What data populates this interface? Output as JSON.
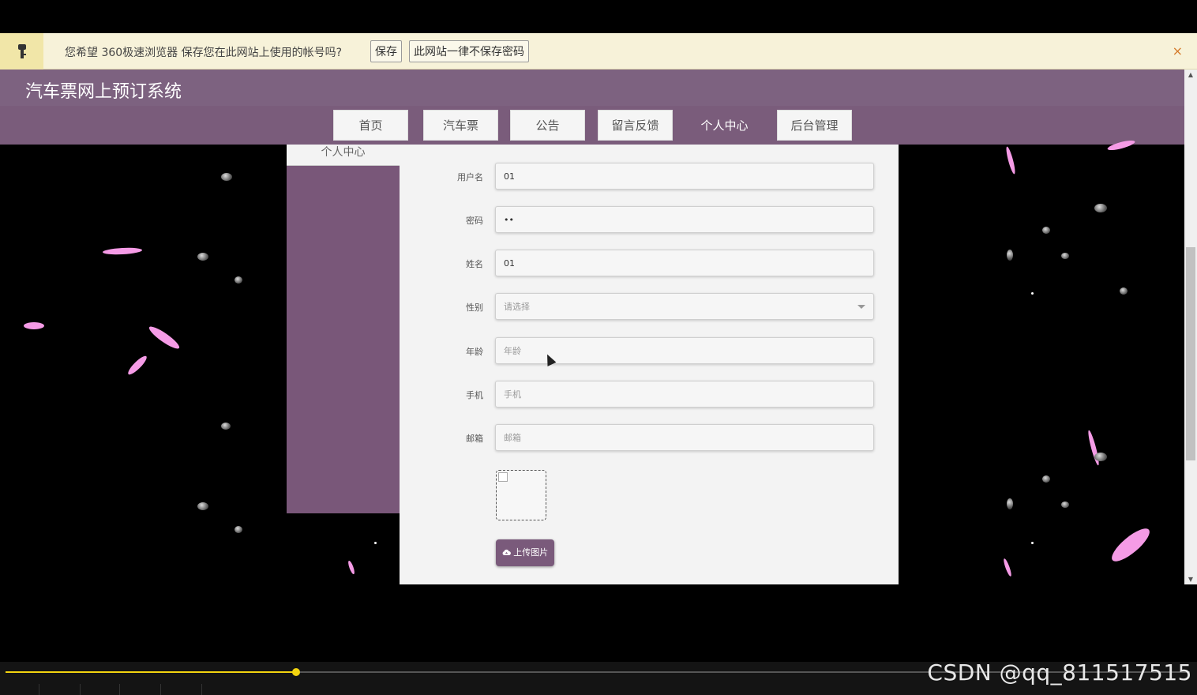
{
  "browser_savebar": {
    "message": "您希望 360极速浏览器 保存您在此网站上使用的帐号吗?",
    "save_label": "保存",
    "never_label": "此网站一律不保存密码",
    "close_label": "×"
  },
  "site": {
    "title": "汽车票网上预订系统"
  },
  "nav": {
    "items": [
      "首页",
      "汽车票",
      "公告",
      "留言反馈",
      "个人中心",
      "后台管理"
    ],
    "active": "个人中心"
  },
  "sidebar": {
    "items": [
      "个人中心"
    ]
  },
  "form": {
    "username": {
      "label": "用户名",
      "value": "01"
    },
    "password": {
      "label": "密码",
      "value": "••"
    },
    "name": {
      "label": "姓名",
      "value": "01"
    },
    "gender": {
      "label": "性别",
      "placeholder": "请选择"
    },
    "age": {
      "label": "年龄",
      "placeholder": "年龄"
    },
    "phone": {
      "label": "手机",
      "placeholder": "手机"
    },
    "email": {
      "label": "邮箱",
      "placeholder": "邮箱"
    },
    "upload_label": "上传图片"
  },
  "video": {
    "progress": 0.245
  },
  "watermark": "CSDN @qq_811517515",
  "colors": {
    "header": "#7d6280",
    "nav": "#7a5c7b",
    "sidebar": "#795779",
    "upload_button": "#7a5a7b",
    "petal": "#f59be6",
    "progress": "#f2d30f"
  },
  "icons": {
    "key": "key-icon",
    "close": "close-icon",
    "upload": "cloud-upload-icon",
    "dropdown": "chevron-down-icon"
  }
}
